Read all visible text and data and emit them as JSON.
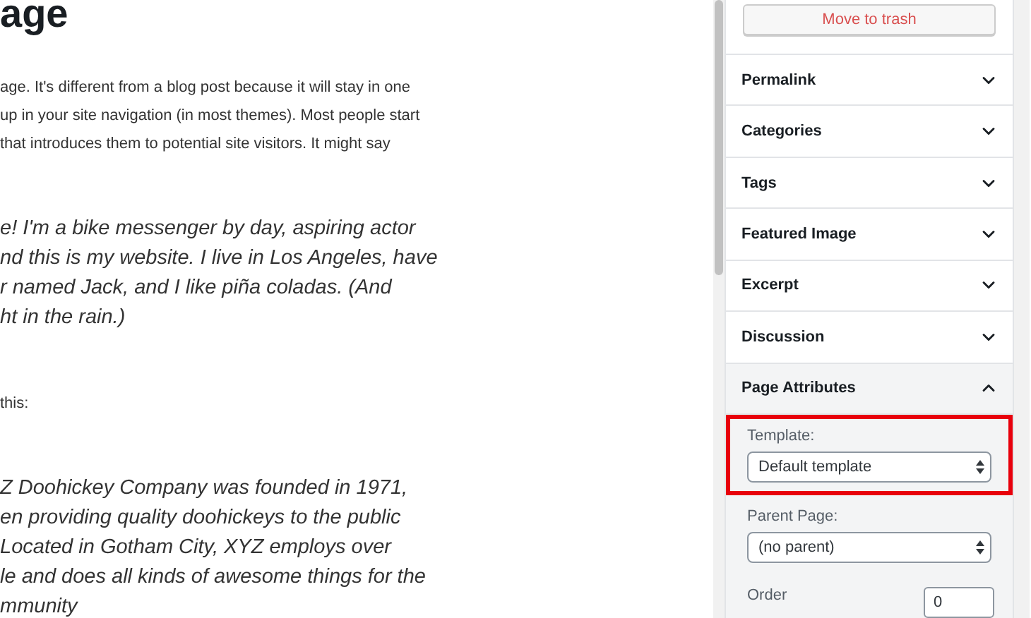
{
  "editor": {
    "heading": "age",
    "blocks": [
      {
        "kind": "body",
        "lines": [
          "age. It's different from a blog post because it will stay in one",
          "up in your site navigation (in most themes). Most people start",
          "that introduces them to potential site visitors. It might say"
        ]
      },
      {
        "kind": "quote",
        "lines": [
          "e! I'm a bike messenger by day, aspiring actor",
          "nd this is my website. I live in Los Angeles, have",
          "r named Jack, and I like piña coladas. (And",
          "ht in the rain.)"
        ]
      },
      {
        "kind": "body",
        "lines": [
          "this:"
        ]
      },
      {
        "kind": "quote",
        "lines": [
          "Z Doohickey Company was founded in 1971,",
          "en providing quality doohickeys to the public",
          "Located in Gotham City, XYZ employs over",
          "le and does all kinds of awesome things for the",
          "mmunity"
        ]
      }
    ]
  },
  "sidebar": {
    "trash_button": "Move to trash",
    "panels": [
      {
        "label": "Permalink",
        "expanded": false
      },
      {
        "label": "Categories",
        "expanded": false
      },
      {
        "label": "Tags",
        "expanded": false
      },
      {
        "label": "Featured Image",
        "expanded": false
      },
      {
        "label": "Excerpt",
        "expanded": false
      },
      {
        "label": "Discussion",
        "expanded": false
      },
      {
        "label": "Page Attributes",
        "expanded": true
      }
    ],
    "page_attributes": {
      "template": {
        "label": "Template:",
        "value": "Default template",
        "highlighted": true
      },
      "parent_page": {
        "label": "Parent Page:",
        "value": "(no parent)",
        "highlighted": false
      },
      "order": {
        "label": "Order",
        "value": "0"
      }
    }
  }
}
